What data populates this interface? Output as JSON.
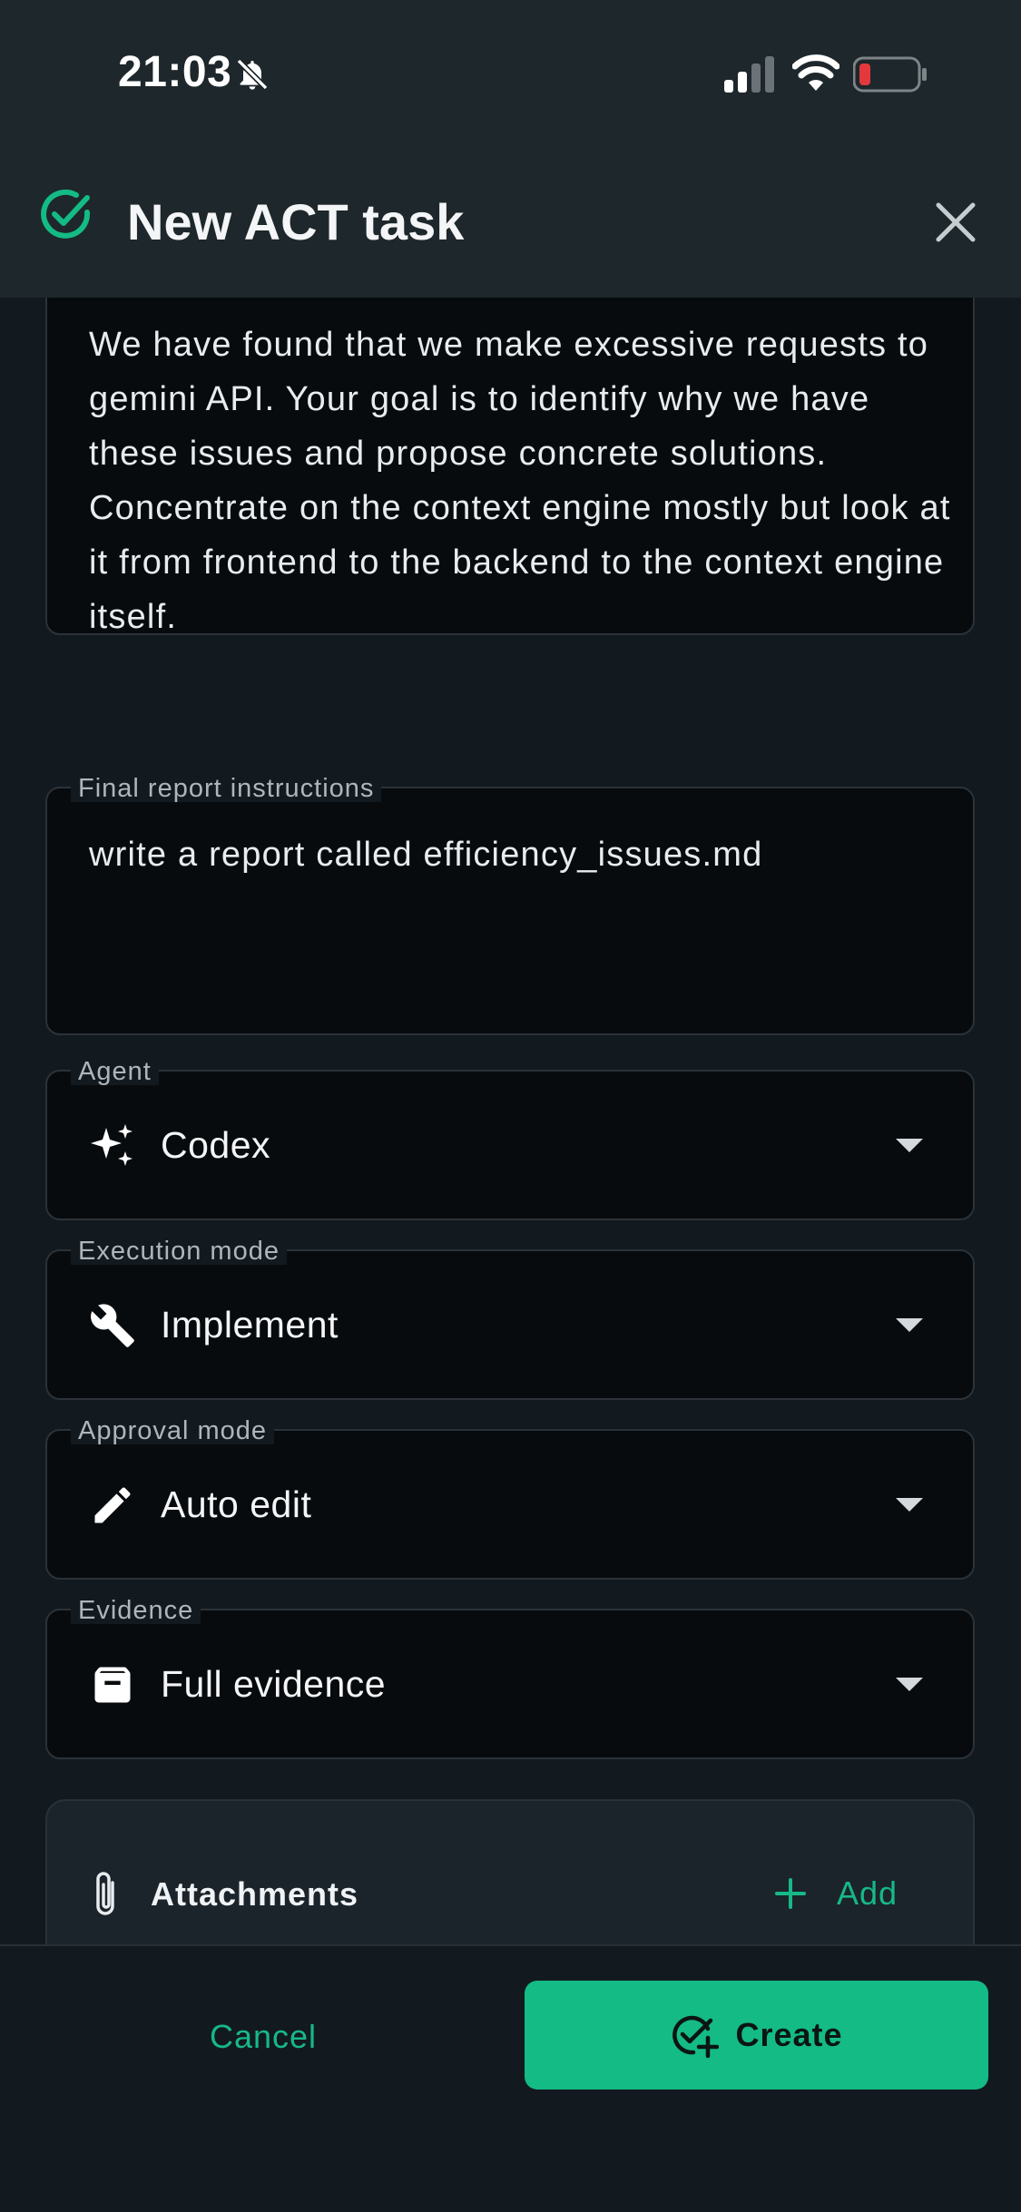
{
  "status_bar": {
    "time": "21:03",
    "icons": [
      "bell-off-icon",
      "signal-icon",
      "wifi-icon",
      "battery-low-icon"
    ]
  },
  "header": {
    "title": "New ACT task",
    "icon": "check-circle-icon",
    "close_icon": "close-icon"
  },
  "form": {
    "description": {
      "value": "We have found that we make excessive requests to gemini API. Your goal is to identify why we have these issues and propose concrete solutions. Concentrate on the context engine mostly but look at it from frontend to the backend to the context engine itself."
    },
    "final_report": {
      "label": "Final report instructions",
      "value": "write a report called efficiency_issues.md"
    },
    "agent": {
      "label": "Agent",
      "value": "Codex",
      "icon": "sparkles-icon"
    },
    "execution_mode": {
      "label": "Execution mode",
      "value": "Implement",
      "icon": "wrench-icon"
    },
    "approval_mode": {
      "label": "Approval mode",
      "value": "Auto edit",
      "icon": "pencil-icon"
    },
    "evidence": {
      "label": "Evidence",
      "value": "Full evidence",
      "icon": "archive-icon"
    }
  },
  "attachments": {
    "label": "Attachments",
    "add_label": "Add"
  },
  "actions": {
    "cancel_label": "Cancel",
    "create_label": "Create"
  },
  "colors": {
    "accent": "#14bb84",
    "background": "#121a20",
    "header": "#1e272b",
    "field_bg": "#080b0e"
  }
}
